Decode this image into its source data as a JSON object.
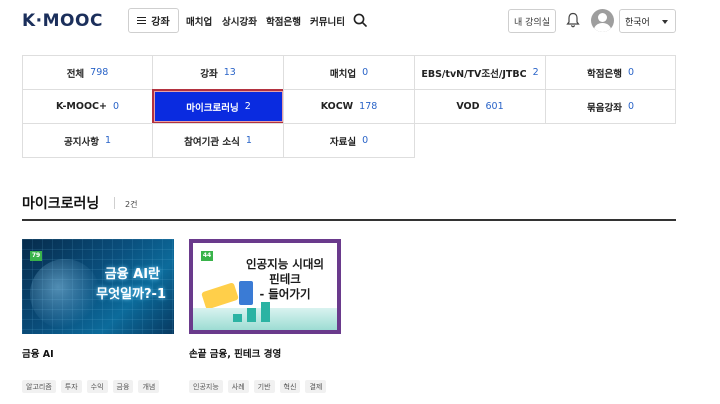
{
  "header": {
    "logo_text": "K·MOOC",
    "nav_button_label": "강좌",
    "menu": [
      "매치업",
      "상시강좌",
      "학점은행",
      "커뮤니티"
    ],
    "my_courses_label": "내 강의실",
    "language": "한국어"
  },
  "categories": [
    {
      "label": "전체",
      "count": "798"
    },
    {
      "label": "강좌",
      "count": "13"
    },
    {
      "label": "매치업",
      "count": "0"
    },
    {
      "label": "EBS/tvN/TV조선/JTBC",
      "count": "2"
    },
    {
      "label": "학점은행",
      "count": "0"
    },
    {
      "label": "K-MOOC+",
      "count": "0"
    },
    {
      "label": "마이크로러닝",
      "count": "2",
      "active": true
    },
    {
      "label": "KOCW",
      "count": "178"
    },
    {
      "label": "VOD",
      "count": "601"
    },
    {
      "label": "묶음강좌",
      "count": "0"
    },
    {
      "label": "공지사항",
      "count": "1"
    },
    {
      "label": "참여기관 소식",
      "count": "1"
    },
    {
      "label": "자료실",
      "count": "0"
    }
  ],
  "section": {
    "title": "마이크로러닝",
    "count": "2건"
  },
  "cards": [
    {
      "title": "금융 AI",
      "thumb_line1": "금융 AI란",
      "thumb_line2": "무엇일까?-1",
      "thumb_number": "79",
      "tags": [
        "알고리즘",
        "투자",
        "수익",
        "금융",
        "개념"
      ]
    },
    {
      "title": "손끝 금융, 핀테크 경영",
      "thumb_line1": "인공지능 시대의",
      "thumb_line2": "핀테크",
      "thumb_line3": "- 들어가기",
      "thumb_number": "44",
      "tags": [
        "인공지능",
        "사례",
        "기반",
        "혁신",
        "결제"
      ]
    }
  ],
  "colors": {
    "active_bg": "#0a2be0",
    "active_border": "#b3323f",
    "count_blue": "#2a64c8",
    "logo_navy": "#1b2f5b",
    "logo_dot": "#25c1c8"
  }
}
